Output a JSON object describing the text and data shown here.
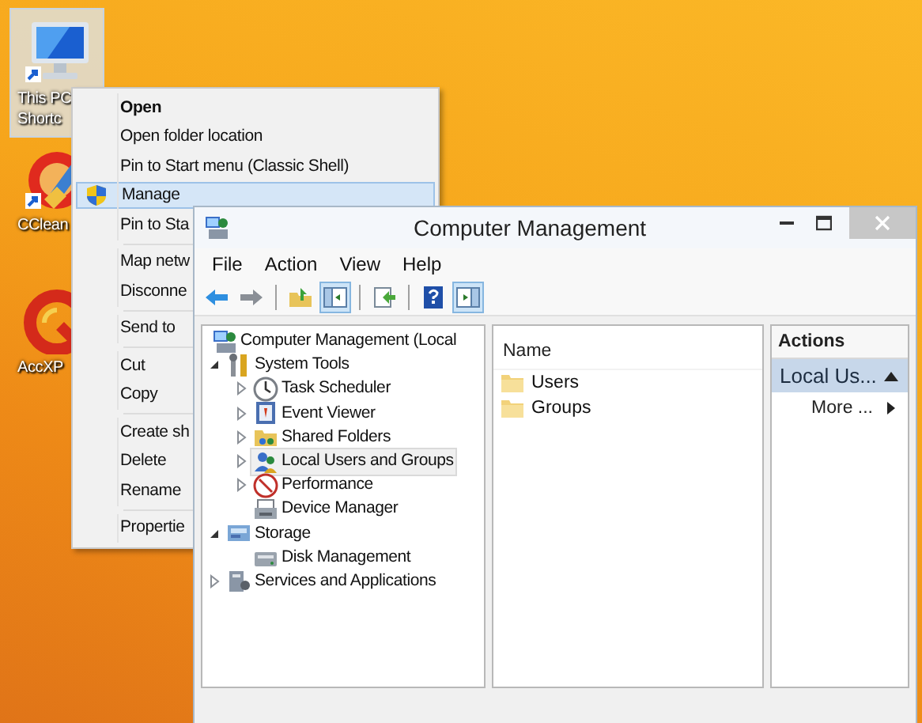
{
  "desktop_icons": [
    {
      "label_lines": [
        "This PC",
        "Shortc"
      ],
      "selected": true
    },
    {
      "label_lines": [
        "CClean"
      ],
      "selected": false
    },
    {
      "label_lines": [
        "AccXP"
      ],
      "selected": false
    }
  ],
  "context_menu": {
    "items": [
      {
        "label": "Open",
        "bold": true,
        "selected": false,
        "shield": false
      },
      {
        "label": "Open folder location",
        "bold": false,
        "selected": false,
        "shield": false
      },
      {
        "label": "Pin to Start menu (Classic Shell)",
        "bold": false,
        "selected": false,
        "shield": false
      },
      {
        "label": "Manage",
        "bold": false,
        "selected": true,
        "shield": true
      },
      {
        "label": "Pin to Sta",
        "bold": false,
        "selected": false,
        "shield": false,
        "separator_after": true
      },
      {
        "label": "Map netw",
        "bold": false,
        "selected": false,
        "shield": false
      },
      {
        "label": "Disconne",
        "bold": false,
        "selected": false,
        "shield": false,
        "separator_after": true
      },
      {
        "label": "Send to",
        "bold": false,
        "selected": false,
        "shield": false,
        "separator_after": true
      },
      {
        "label": "Cut",
        "bold": false,
        "selected": false,
        "shield": false
      },
      {
        "label": "Copy",
        "bold": false,
        "selected": false,
        "shield": false,
        "separator_after": true
      },
      {
        "label": "Create sh",
        "bold": false,
        "selected": false,
        "shield": false
      },
      {
        "label": "Delete",
        "bold": false,
        "selected": false,
        "shield": false
      },
      {
        "label": "Rename",
        "bold": false,
        "selected": false,
        "shield": false,
        "separator_after": true
      },
      {
        "label": "Propertie",
        "bold": false,
        "selected": false,
        "shield": false
      }
    ]
  },
  "window": {
    "title": "Computer Management",
    "menu": [
      "File",
      "Action",
      "View",
      "Help"
    ],
    "toolbar": [
      {
        "kind": "button",
        "pressed": false
      },
      {
        "kind": "button",
        "pressed": false
      },
      {
        "kind": "separator"
      },
      {
        "kind": "button",
        "pressed": false
      },
      {
        "kind": "button",
        "pressed": true
      },
      {
        "kind": "separator"
      },
      {
        "kind": "button",
        "pressed": false
      },
      {
        "kind": "separator"
      },
      {
        "kind": "button",
        "pressed": false
      },
      {
        "kind": "button",
        "pressed": true
      }
    ],
    "tree": [
      {
        "label": "Computer Management (Local",
        "kind": "root",
        "selected": false,
        "children": [
          {
            "label": "System Tools",
            "kind": "branch",
            "expanded": true,
            "selected": false,
            "children": [
              {
                "label": "Task Scheduler",
                "kind": "branch",
                "expanded": false,
                "selected": false
              },
              {
                "label": "Event Viewer",
                "kind": "branch",
                "expanded": false,
                "selected": false
              },
              {
                "label": "Shared Folders",
                "kind": "branch",
                "expanded": false,
                "selected": false
              },
              {
                "label": "Local Users and Groups",
                "kind": "branch",
                "expanded": false,
                "selected": true
              },
              {
                "label": "Performance",
                "kind": "branch",
                "expanded": false,
                "selected": false
              },
              {
                "label": "Device Manager",
                "kind": "leaf",
                "selected": false
              }
            ]
          },
          {
            "label": "Storage",
            "kind": "branch",
            "expanded": true,
            "selected": false,
            "children": [
              {
                "label": "Disk Management",
                "kind": "leaf",
                "selected": false
              }
            ]
          },
          {
            "label": "Services and Applications",
            "kind": "branch",
            "expanded": false,
            "selected": false
          }
        ]
      }
    ],
    "list": {
      "columns": [
        "Name"
      ],
      "rows": [
        "Users",
        "Groups"
      ]
    },
    "actions": {
      "title": "Actions",
      "section": {
        "label": "Local Us...",
        "expanded": true
      },
      "items": [
        {
          "label": "More ...",
          "submenu": true
        }
      ]
    }
  }
}
